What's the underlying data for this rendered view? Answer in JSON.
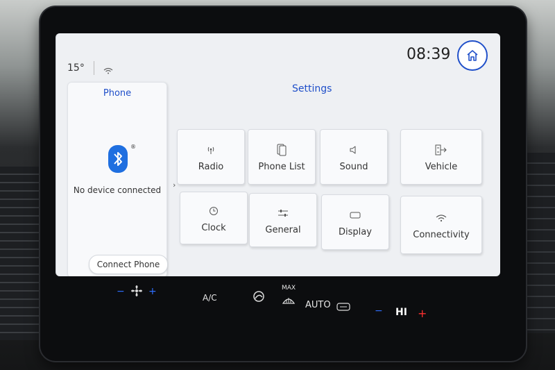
{
  "status": {
    "temperature": "15°",
    "time": "08:39"
  },
  "phone": {
    "title": "Phone",
    "message": "No device connected",
    "connect_label": "Connect Phone",
    "bluetooth_reg": "®"
  },
  "settings": {
    "title": "Settings",
    "tiles": [
      {
        "label": "Radio",
        "icon": "radio-antenna-icon"
      },
      {
        "label": "Phone List",
        "icon": "phone-list-icon"
      },
      {
        "label": "Sound",
        "icon": "speaker-icon"
      },
      {
        "label": "Vehicle",
        "icon": "vehicle-icon"
      },
      {
        "label": "Clock",
        "icon": "clock-icon"
      },
      {
        "label": "General",
        "icon": "sliders-icon"
      },
      {
        "label": "Display",
        "icon": "display-icon"
      },
      {
        "label": "Connectivity",
        "icon": "wifi-icon"
      }
    ]
  },
  "climate": {
    "ac_label": "A/C",
    "max_label": "MAX",
    "auto_label": "AUTO",
    "fan_level": "HI",
    "minus": "−",
    "plus": "+"
  },
  "colors": {
    "accent": "#1f4fc9",
    "screen_bg": "#eef0f3",
    "tile_bg": "#f9fafc"
  }
}
